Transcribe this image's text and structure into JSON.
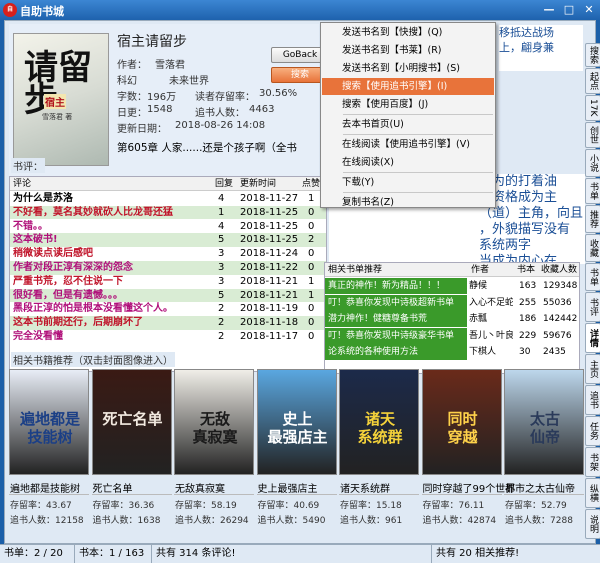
{
  "window": {
    "title": "自助书城",
    "icon_text": "自"
  },
  "book": {
    "title": "宿主请留步",
    "author_label": "作者：",
    "author": "雪落君",
    "category_label": "科幻",
    "category": "未来世界",
    "words_label": "字数：",
    "words": "196万",
    "ratio_label": "读者存留率：",
    "ratio": "30.56%",
    "views_label": "日更：",
    "views": "1548",
    "followers_label": "追书人数：",
    "followers": "4463",
    "update_label": "更新日期：",
    "update": "2018-08-26 14:08",
    "latest_chapter": "第605章 人家......还是个孩子啊（全书"
  },
  "cover": {
    "title_big": "请留步",
    "title_small": "宿主",
    "author_small": "雪落君 著"
  },
  "buttons": {
    "goback": "GoBack",
    "search": "搜索"
  },
  "description": {
    "top": "移抵达战场\n上，翩身兼",
    "middle": "人为的打着油\n么资格成为主\n（道）主角，向且\n，外貌描写没有\n系统两字\n当成为内心在"
  },
  "comments": {
    "section_label": "书评：",
    "headers": {
      "comment": "评论",
      "replies": "回复",
      "time": "更新时间",
      "likes": "点赞"
    },
    "rows": [
      {
        "text": "为什么是苏洛",
        "replies": "4",
        "time": "2018-11-27",
        "likes": "1",
        "color": "#000000",
        "bg": "#ffffff",
        "bold": true
      },
      {
        "text": "不好看，莫名其妙就砍人比龙哥还猛",
        "replies": "1",
        "time": "2018-11-25",
        "likes": "0",
        "color": "#c0142a",
        "bg": "#d9ecd4",
        "bold": true
      },
      {
        "text": "不错。。",
        "replies": "4",
        "time": "2018-11-25",
        "likes": "0",
        "color": "#b0107a",
        "bg": "#ffffff",
        "bold": true
      },
      {
        "text": "这本破书!",
        "replies": "5",
        "time": "2018-11-25",
        "likes": "2",
        "color": "#b0107a",
        "bg": "#d9ecd4",
        "bold": true
      },
      {
        "text": "稍微读点读后感吧",
        "replies": "3",
        "time": "2018-11-24",
        "likes": "0",
        "color": "#c0142a",
        "bg": "#ffffff",
        "bold": true
      },
      {
        "text": "作者对段正淳有深深的怨念",
        "replies": "3",
        "time": "2018-11-22",
        "likes": "0",
        "color": "#b0107a",
        "bg": "#d9ecd4",
        "bold": true
      },
      {
        "text": "严重书荒，忍不住说一下",
        "replies": "3",
        "time": "2018-11-21",
        "likes": "1",
        "color": "#c0142a",
        "bg": "#ffffff",
        "bold": true
      },
      {
        "text": "很好看，但是有遗憾。。。",
        "replies": "5",
        "time": "2018-11-21",
        "likes": "1",
        "color": "#b0107a",
        "bg": "#d9ecd4",
        "bold": true
      },
      {
        "text": "黑段正淳的怕是根本没看懂这个人。",
        "replies": "2",
        "time": "2018-11-19",
        "likes": "0",
        "color": "#b0107a",
        "bg": "#ffffff",
        "bold": true
      },
      {
        "text": "这本书前期还行，后期崩坏了",
        "replies": "2",
        "time": "2018-11-18",
        "likes": "0",
        "color": "#c0142a",
        "bg": "#d9ecd4",
        "bold": true
      },
      {
        "text": "完全没看懂",
        "replies": "2",
        "time": "2018-11-17",
        "likes": "0",
        "color": "#b0107a",
        "bg": "#ffffff",
        "bold": true
      }
    ]
  },
  "recommend": {
    "headers": {
      "title": "相关书单推荐",
      "author": "作者",
      "count": "书本",
      "collect": "收藏人数"
    },
    "rows": [
      {
        "title": "真正的神作！新为精品！！！",
        "author": "静候",
        "count": "163",
        "collect": "129348",
        "bg": "#3a9a2a",
        "color": "#ffffff"
      },
      {
        "title": "叮！恭喜你发现中诗极超新书单",
        "author": "入心不足蛇吞象",
        "count": "255",
        "collect": "55036",
        "bg": "#3a9a2a",
        "color": "#ffffff"
      },
      {
        "title": "潜力神作！健糖尊备书荒",
        "author": "赤瓢",
        "count": "186",
        "collect": "142442",
        "bg": "#3a9a2a",
        "color": "#ffffff"
      },
      {
        "title": "叮！恭喜你发现中诗级豪华书单",
        "author": "吾儿丶叶良辰",
        "count": "229",
        "collect": "59676",
        "bg": "#3a9a2a",
        "color": "#ffffff"
      },
      {
        "title": "论系统的各种使用方法",
        "author": "下棋人",
        "count": "30",
        "collect": "2435",
        "bg": "#3a9a2a",
        "color": "#ffffff"
      }
    ]
  },
  "related": {
    "label": "相关书籍推荐（双击封面图像进入）",
    "retention_label": "存留率：",
    "readers_label": "追书人数：",
    "books": [
      {
        "title": "遍地都是技能树",
        "cover_text": "遍地都是\n技能树",
        "retention": "43.67",
        "readers": "12158",
        "bg": "#e8edf6",
        "fg": "#1b3f86"
      },
      {
        "title": "死亡名单",
        "cover_text": "死亡名单",
        "retention": "36.36",
        "readers": "1638",
        "bg": "#3a1a14",
        "fg": "#f2e9e0"
      },
      {
        "title": "无敌真寂寞",
        "cover_text": "无敌\n真寂寞",
        "retention": "58.19",
        "readers": "26294",
        "bg": "#f0eee8",
        "fg": "#1a1a1a"
      },
      {
        "title": "史上最强店主",
        "cover_text": "史上\n最强店主",
        "retention": "40.69",
        "readers": "5490",
        "bg": "#5aa7e0",
        "fg": "#ffffff"
      },
      {
        "title": "诸天系统群",
        "cover_text": "诸天\n系统群",
        "retention": "15.18",
        "readers": "961",
        "bg": "#1c2a4a",
        "fg": "#f4d23a"
      },
      {
        "title": "同时穿越了99个世界",
        "cover_text": "同时\n穿越",
        "retention": "76.11",
        "readers": "42874",
        "bg": "#6a2a1a",
        "fg": "#ffd24a"
      },
      {
        "title": "都市之太古仙帝",
        "cover_text": "太古\n仙帝",
        "retention": "52.79",
        "readers": "7288",
        "bg": "#bdd7ec",
        "fg": "#2a3a5a"
      }
    ]
  },
  "sidetabs": [
    "搜索",
    "起点",
    "17K",
    "创世",
    "小说",
    "书单",
    "推荐",
    "收藏",
    "书单",
    "书评",
    "详情",
    "主页",
    "追书",
    "任务",
    "书架",
    "纵横",
    "说明"
  ],
  "status": {
    "books": "书单：2 / 20",
    "page": "书本：1 / 163",
    "comments": "共有 314 条评论!",
    "related": "共有 20 相关推荐!"
  },
  "menu": {
    "items": [
      {
        "label": "发送书名到【快搜】(Q)",
        "selected": false
      },
      {
        "label": "发送书名到【书莱】(R)",
        "selected": false
      },
      {
        "label": "发送书名到【小明搜书】(S)",
        "selected": false
      },
      {
        "label": "搜索【使用追书引擎】(I)",
        "selected": true
      },
      {
        "label": "搜索【使用百度】(J)",
        "selected": false
      },
      {
        "label": "去本书首页(U)",
        "selected": false
      },
      {
        "label": "在线阅读【使用追书引擎】(V)",
        "selected": false
      },
      {
        "label": "在线阅读(X)",
        "selected": false
      },
      {
        "label": "下载(Y)",
        "selected": false
      },
      {
        "label": "复制书名(Z)",
        "selected": false
      }
    ]
  }
}
